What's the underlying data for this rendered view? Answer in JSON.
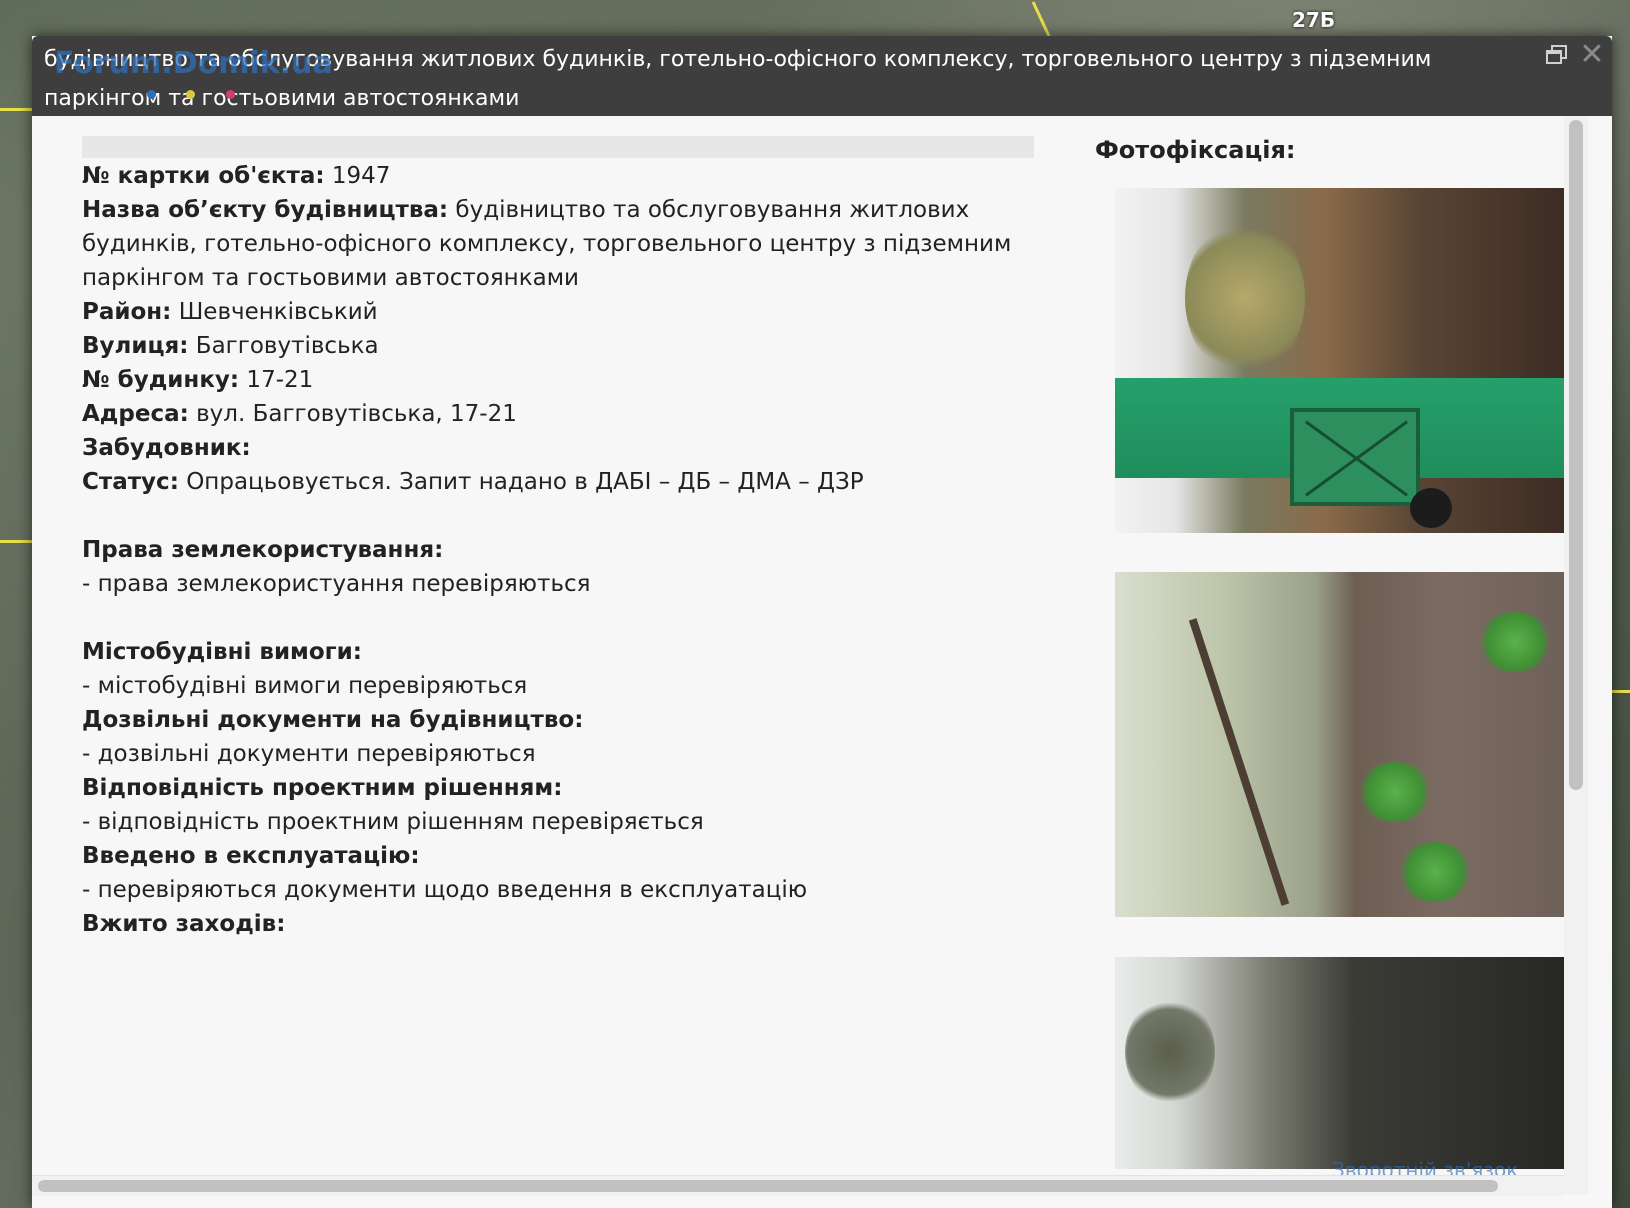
{
  "dialog": {
    "title": "будівництво та обслуговування житлових будинків, готельно-офісного комплексу, торговельного центру з підземним паркінгом та гостьовими автостоянками"
  },
  "map": {
    "label": "27Б",
    "watermark": "Forum.Domik.ua"
  },
  "fields": {
    "card_no": {
      "label": "№ картки об'єкта:",
      "value": " 1947"
    },
    "name": {
      "label": "Назва об’єкту будівництва:",
      "value": " будівництво та обслуговування житлових будинків, готельно-офісного комплексу, торговельного центру з підземним паркінгом та гостьовими автостоянками"
    },
    "district": {
      "label": "Район:",
      "value": " Шевченківський"
    },
    "street": {
      "label": "Вулиця:",
      "value": " Багговутівська"
    },
    "house": {
      "label": "№ будинку:",
      "value": " 17-21"
    },
    "address": {
      "label": "Адреса:",
      "value": " вул. Багговутівська, 17-21"
    },
    "developer": {
      "label": "Забудовник:",
      "value": ""
    },
    "status": {
      "label": "Статус:",
      "value": " Опрацьовується. Запит надано в ДАБІ – ДБ – ДМА – ДЗР"
    }
  },
  "sections": {
    "land": {
      "heading": "Права землекористування:",
      "text": "- права землекористуання перевіряються"
    },
    "urban": {
      "heading": "Містобудівні вимоги:",
      "text": "- містобудівні вимоги перевіряються"
    },
    "permits": {
      "heading": "Дозвільні документи на будівництво:",
      "text": "- дозвільні документи перевіряються"
    },
    "compliance": {
      "heading": "Відповідність проектним рішенням:",
      "text": "- відповідність проектним рішенням перевіряється"
    },
    "commissioned": {
      "heading": "Введено в експлуатацію:",
      "text": "- перевіряються документи щодо введення в експлуатацію"
    },
    "measures": {
      "heading": "Вжито заходів:"
    }
  },
  "photos": {
    "title": "Фотофіксація:",
    "items": [
      "construction-site-gate-photo",
      "trees-and-ground-photo",
      "fence-and-trees-photo"
    ]
  },
  "footer": {
    "feedback": "Зворотній зв'язок"
  },
  "colors": {
    "titlebar": "#3e3e3e",
    "content_bg": "#f7f7f7",
    "accent_link": "#2f6fb8"
  }
}
